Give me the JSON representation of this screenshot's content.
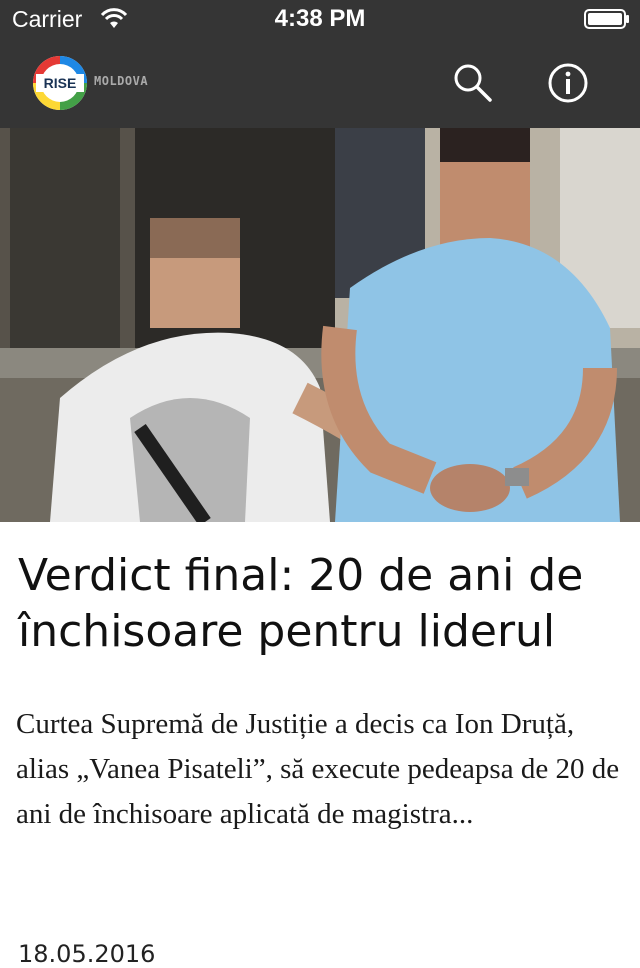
{
  "status_bar": {
    "carrier": "Carrier",
    "time": "4:38 PM"
  },
  "nav": {
    "logo_text": "RISE",
    "logo_subtitle": "MOLDOVA",
    "search_icon": "search-icon",
    "info_icon": "info-icon"
  },
  "colors": {
    "header_bg": "#353535",
    "accent_ring": [
      "#e53935",
      "#1e88e5",
      "#43a047",
      "#fdd835"
    ]
  },
  "article": {
    "title": "Verdict final: 20 de ani de închisoare pentru liderul",
    "excerpt": "Curtea Supremă de Justiție a decis ca Ion Druță, alias „Vanea Pisateli”, să execute pedeapsa de 20 de ani de închisoare aplicată de magistra...",
    "date": "18.05.2016"
  }
}
